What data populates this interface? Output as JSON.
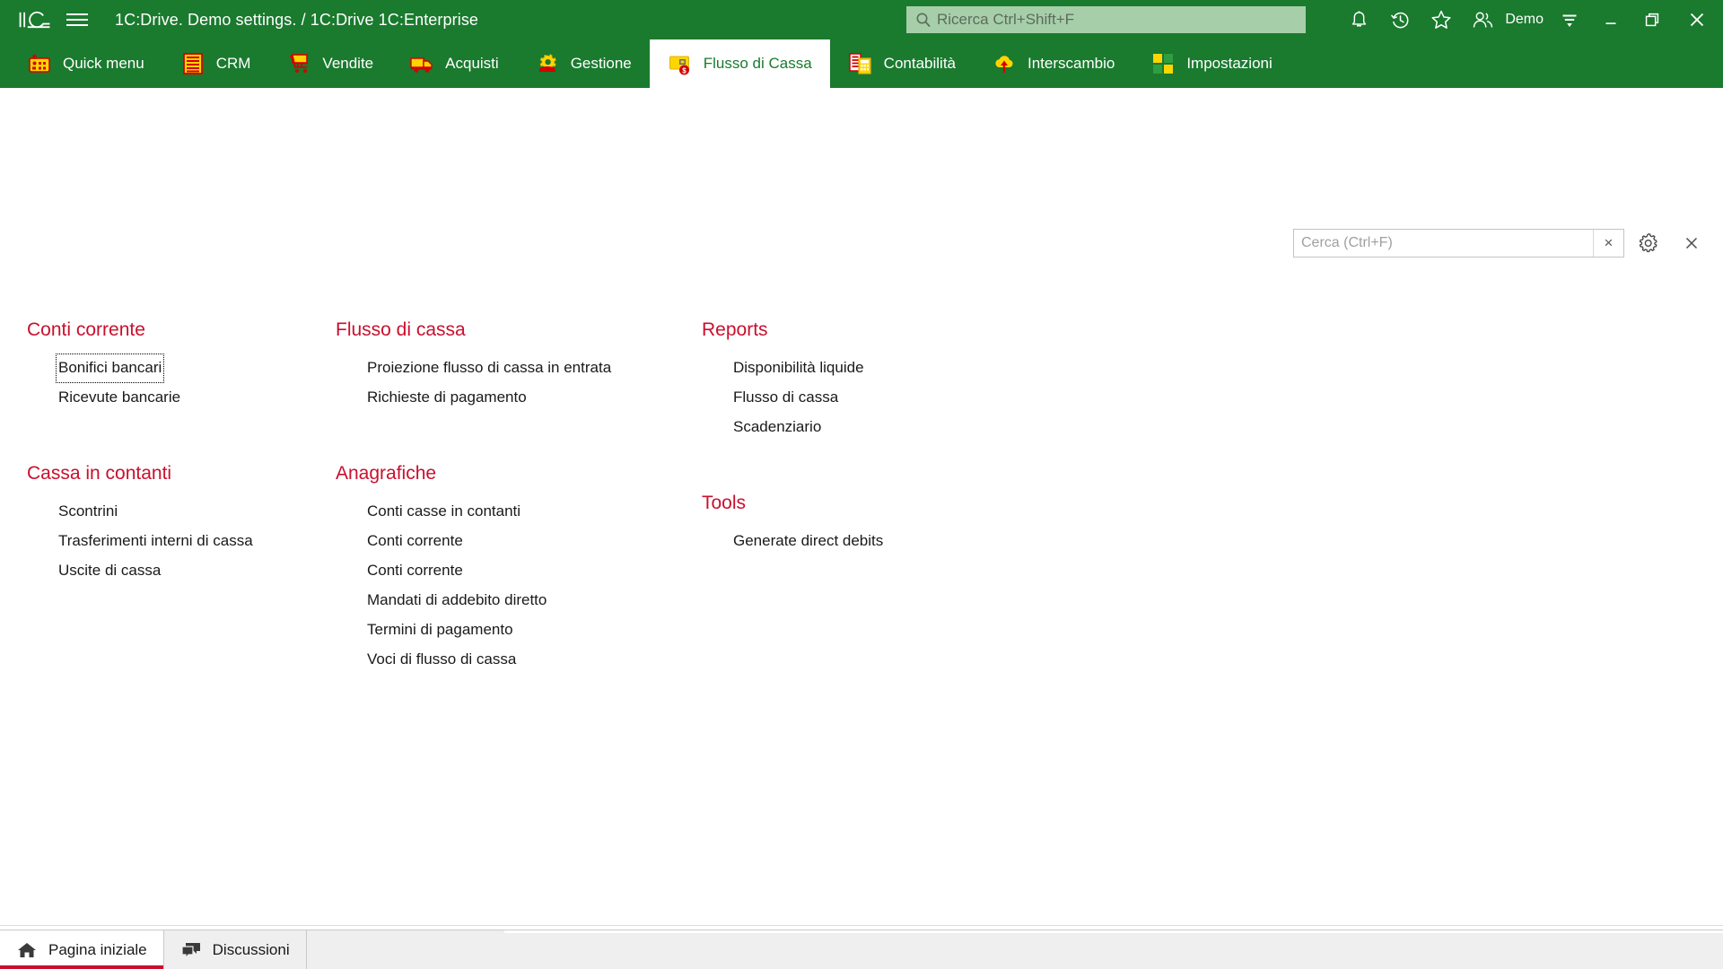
{
  "titlebar": {
    "logo_icon": "1c-logo-icon",
    "menu_icon": "hamburger-menu-icon",
    "title": "1C:Drive. Demo settings. / 1C:Drive 1C:Enterprise",
    "search": {
      "icon": "search-icon",
      "placeholder": "Ricerca Ctrl+Shift+F",
      "value": ""
    },
    "icons": [
      {
        "name": "notifications-bell-icon",
        "label": ""
      },
      {
        "name": "history-clock-icon",
        "label": ""
      },
      {
        "name": "favorites-star-icon",
        "label": ""
      },
      {
        "name": "user-accounts-icon",
        "label": ""
      }
    ],
    "user_label": "Demo",
    "user_menu_icon": "user-menu-chevron-icon",
    "window_controls": {
      "minimize": "minimize-icon",
      "restore": "restore-window-icon",
      "close": "close-window-icon"
    }
  },
  "sections": [
    {
      "label": "Quick menu",
      "icon": "quick-menu-icon",
      "active": false
    },
    {
      "label": "CRM",
      "icon": "crm-icon",
      "active": false
    },
    {
      "label": "Vendite",
      "icon": "sales-cart-icon",
      "active": false
    },
    {
      "label": "Acquisti",
      "icon": "purchases-truck-icon",
      "active": false
    },
    {
      "label": "Gestione",
      "icon": "management-gear-icon",
      "active": false
    },
    {
      "label": "Flusso di Cassa",
      "icon": "cash-flow-icon",
      "active": true
    },
    {
      "label": "Contabilità",
      "icon": "accounting-icon",
      "active": false
    },
    {
      "label": "Interscambio",
      "icon": "exchange-cloud-icon",
      "active": false
    },
    {
      "label": "Impostazioni",
      "icon": "settings-grid-icon",
      "active": false
    }
  ],
  "command_bar": {
    "search_placeholder": "Cerca (Ctrl+F)",
    "search_value": "",
    "clear_label": "×",
    "settings_icon": "gear-icon",
    "close_label": "×",
    "close_icon": "close-icon"
  },
  "content": {
    "columns": [
      {
        "groups": [
          {
            "title": "Conti corrente",
            "links": [
              {
                "label": "Bonifici bancari",
                "focused": true
              },
              {
                "label": "Ricevute bancarie",
                "focused": false
              }
            ]
          },
          {
            "title": "Cassa in contanti",
            "links": [
              {
                "label": "Scontrini",
                "focused": false
              },
              {
                "label": "Trasferimenti interni di cassa",
                "focused": false
              },
              {
                "label": "Uscite di cassa",
                "focused": false
              }
            ]
          }
        ]
      },
      {
        "groups": [
          {
            "title": "Flusso di cassa",
            "links": [
              {
                "label": "Proiezione flusso di cassa in entrata",
                "focused": false
              },
              {
                "label": "Richieste di pagamento",
                "focused": false
              }
            ]
          },
          {
            "title": "Anagrafiche",
            "links": [
              {
                "label": "Conti casse in contanti",
                "focused": false
              },
              {
                "label": "Conti corrente",
                "focused": false
              },
              {
                "label": "Conti corrente",
                "focused": false
              },
              {
                "label": "Mandati di addebito diretto",
                "focused": false
              },
              {
                "label": "Termini di pagamento",
                "focused": false
              },
              {
                "label": "Voci di flusso di cassa",
                "focused": false
              }
            ]
          }
        ]
      },
      {
        "groups": [
          {
            "title": "Reports",
            "links": [
              {
                "label": "Disponibilità liquide",
                "focused": false
              },
              {
                "label": "Flusso di cassa",
                "focused": false
              },
              {
                "label": "Scadenziario",
                "focused": false
              }
            ]
          },
          {
            "title": "Tools",
            "links": [
              {
                "label": "Generate direct debits",
                "focused": false
              }
            ]
          }
        ]
      }
    ]
  },
  "taskbar": {
    "items": [
      {
        "label": "Pagina iniziale",
        "icon": "home-icon",
        "active": true
      },
      {
        "label": "Discussioni",
        "icon": "chat-bubbles-icon",
        "active": false
      }
    ]
  },
  "colors": {
    "brand_green": "#1a7a2e",
    "group_heading_red": "#c8102e",
    "search_field_green": "#a6cfa9",
    "active_tab_bg": "#ffffff",
    "link_text": "#1a1a1a",
    "taskbar_bg": "#efefef"
  }
}
